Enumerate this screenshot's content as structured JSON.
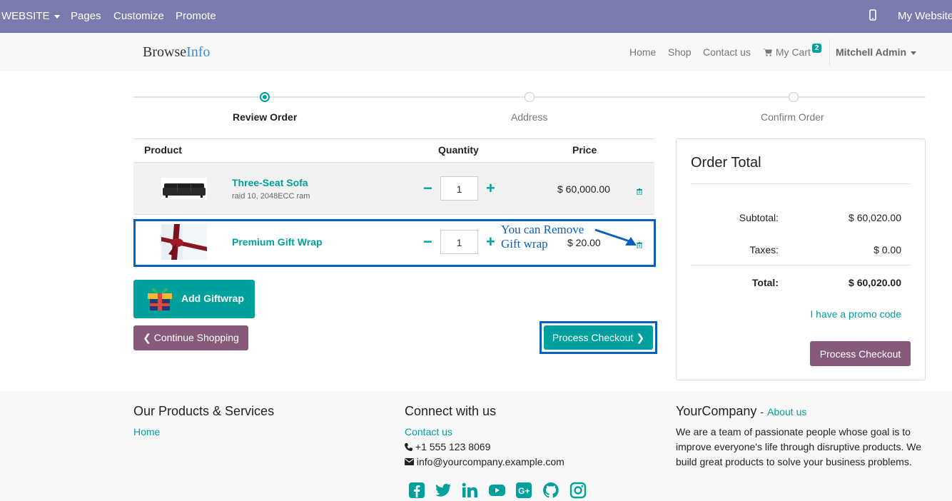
{
  "admin_bar": {
    "website_menu": "WEBSITE",
    "pages": "Pages",
    "customize": "Customize",
    "promote": "Promote",
    "my_website": "My Website",
    "icon": "mobile-phone-icon"
  },
  "nav": {
    "logo_browse": "Browse",
    "logo_info": "Info",
    "home": "Home",
    "shop": "Shop",
    "contact": "Contact us",
    "cart": "My Cart",
    "cart_count": "2",
    "user": "Mitchell Admin"
  },
  "wizard": {
    "steps": [
      "Review Order",
      "Address",
      "Confirm Order"
    ],
    "active_step": 0
  },
  "cart_table": {
    "headers": {
      "product": "Product",
      "quantity": "Quantity",
      "price": "Price"
    },
    "rows": [
      {
        "name": "Three-Seat Sofa",
        "desc": "raid 10, 2048ECC ram",
        "qty": "1",
        "price": "$ 60,000.00",
        "image": "sofa"
      },
      {
        "name": "Premium Gift Wrap",
        "desc": "",
        "qty": "1",
        "price": "$ 20.00",
        "image": "gift-ribbon"
      }
    ]
  },
  "annotation": {
    "line1": "You can Remove",
    "line2": "Gift wrap"
  },
  "buttons": {
    "add_giftwrap": "Add Giftwrap",
    "continue_shopping": "Continue Shopping",
    "process_checkout": "Process Checkout"
  },
  "order_total": {
    "title": "Order Total",
    "subtotal_label": "Subtotal:",
    "subtotal": "$ 60,020.00",
    "taxes_label": "Taxes:",
    "taxes": "$ 0.00",
    "total_label": "Total:",
    "total": "$ 60,020.00",
    "promo": "I have a promo code",
    "checkout": "Process Checkout"
  },
  "footer": {
    "col1_title": "Our Products & Services",
    "col1_home": "Home",
    "col2_title": "Connect with us",
    "col2_contact": "Contact us",
    "phone": "+1 555 123 8069",
    "email": "info@yourcompany.example.com",
    "col3_title": "YourCompany",
    "col3_sep": "-",
    "about": "About us",
    "about_text": "We are a team of passionate people whose goal is to improve everyone's life through disruptive products. We build great products to solve your business problems.",
    "social_icons": [
      "facebook-icon",
      "twitter-icon",
      "linkedin-icon",
      "youtube-icon",
      "google-plus-icon",
      "github-icon",
      "instagram-icon"
    ]
  },
  "colors": {
    "accent": "#00a09d",
    "admin_bar": "#7c7bad",
    "primary_button": "#875a7b",
    "highlight": "#0b5fbf"
  }
}
